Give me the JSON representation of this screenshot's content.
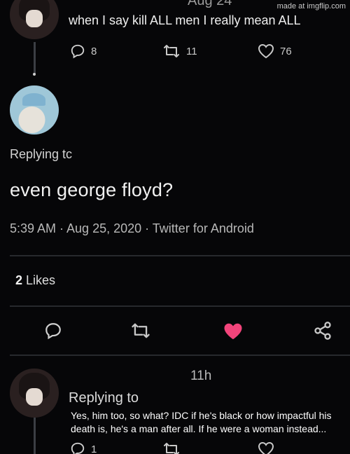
{
  "watermark": "made at imgflip.com",
  "top_tweet": {
    "date": "Aug 24",
    "text": "when I say kill ALL men I really mean ALL",
    "reply_count": "8",
    "retweet_count": "11",
    "like_count": "76"
  },
  "main_tweet": {
    "replying_to": "Replying tc",
    "text": "even george floyd?",
    "timestamp": "5:39 AM · Aug 25, 2020 · Twitter for Android",
    "likes_count": "2",
    "likes_label": " Likes",
    "like_color": "#f2447b"
  },
  "reply_tweet": {
    "time": "11h",
    "replying_to": "Replying to",
    "caption": "Yes, him too, so what? IDC if he's black or how impactful his death is, he's a man after all. If he were a woman instead...",
    "reply_count": "1"
  },
  "icons": [
    "reply-icon",
    "retweet-icon",
    "like-icon",
    "share-icon"
  ]
}
